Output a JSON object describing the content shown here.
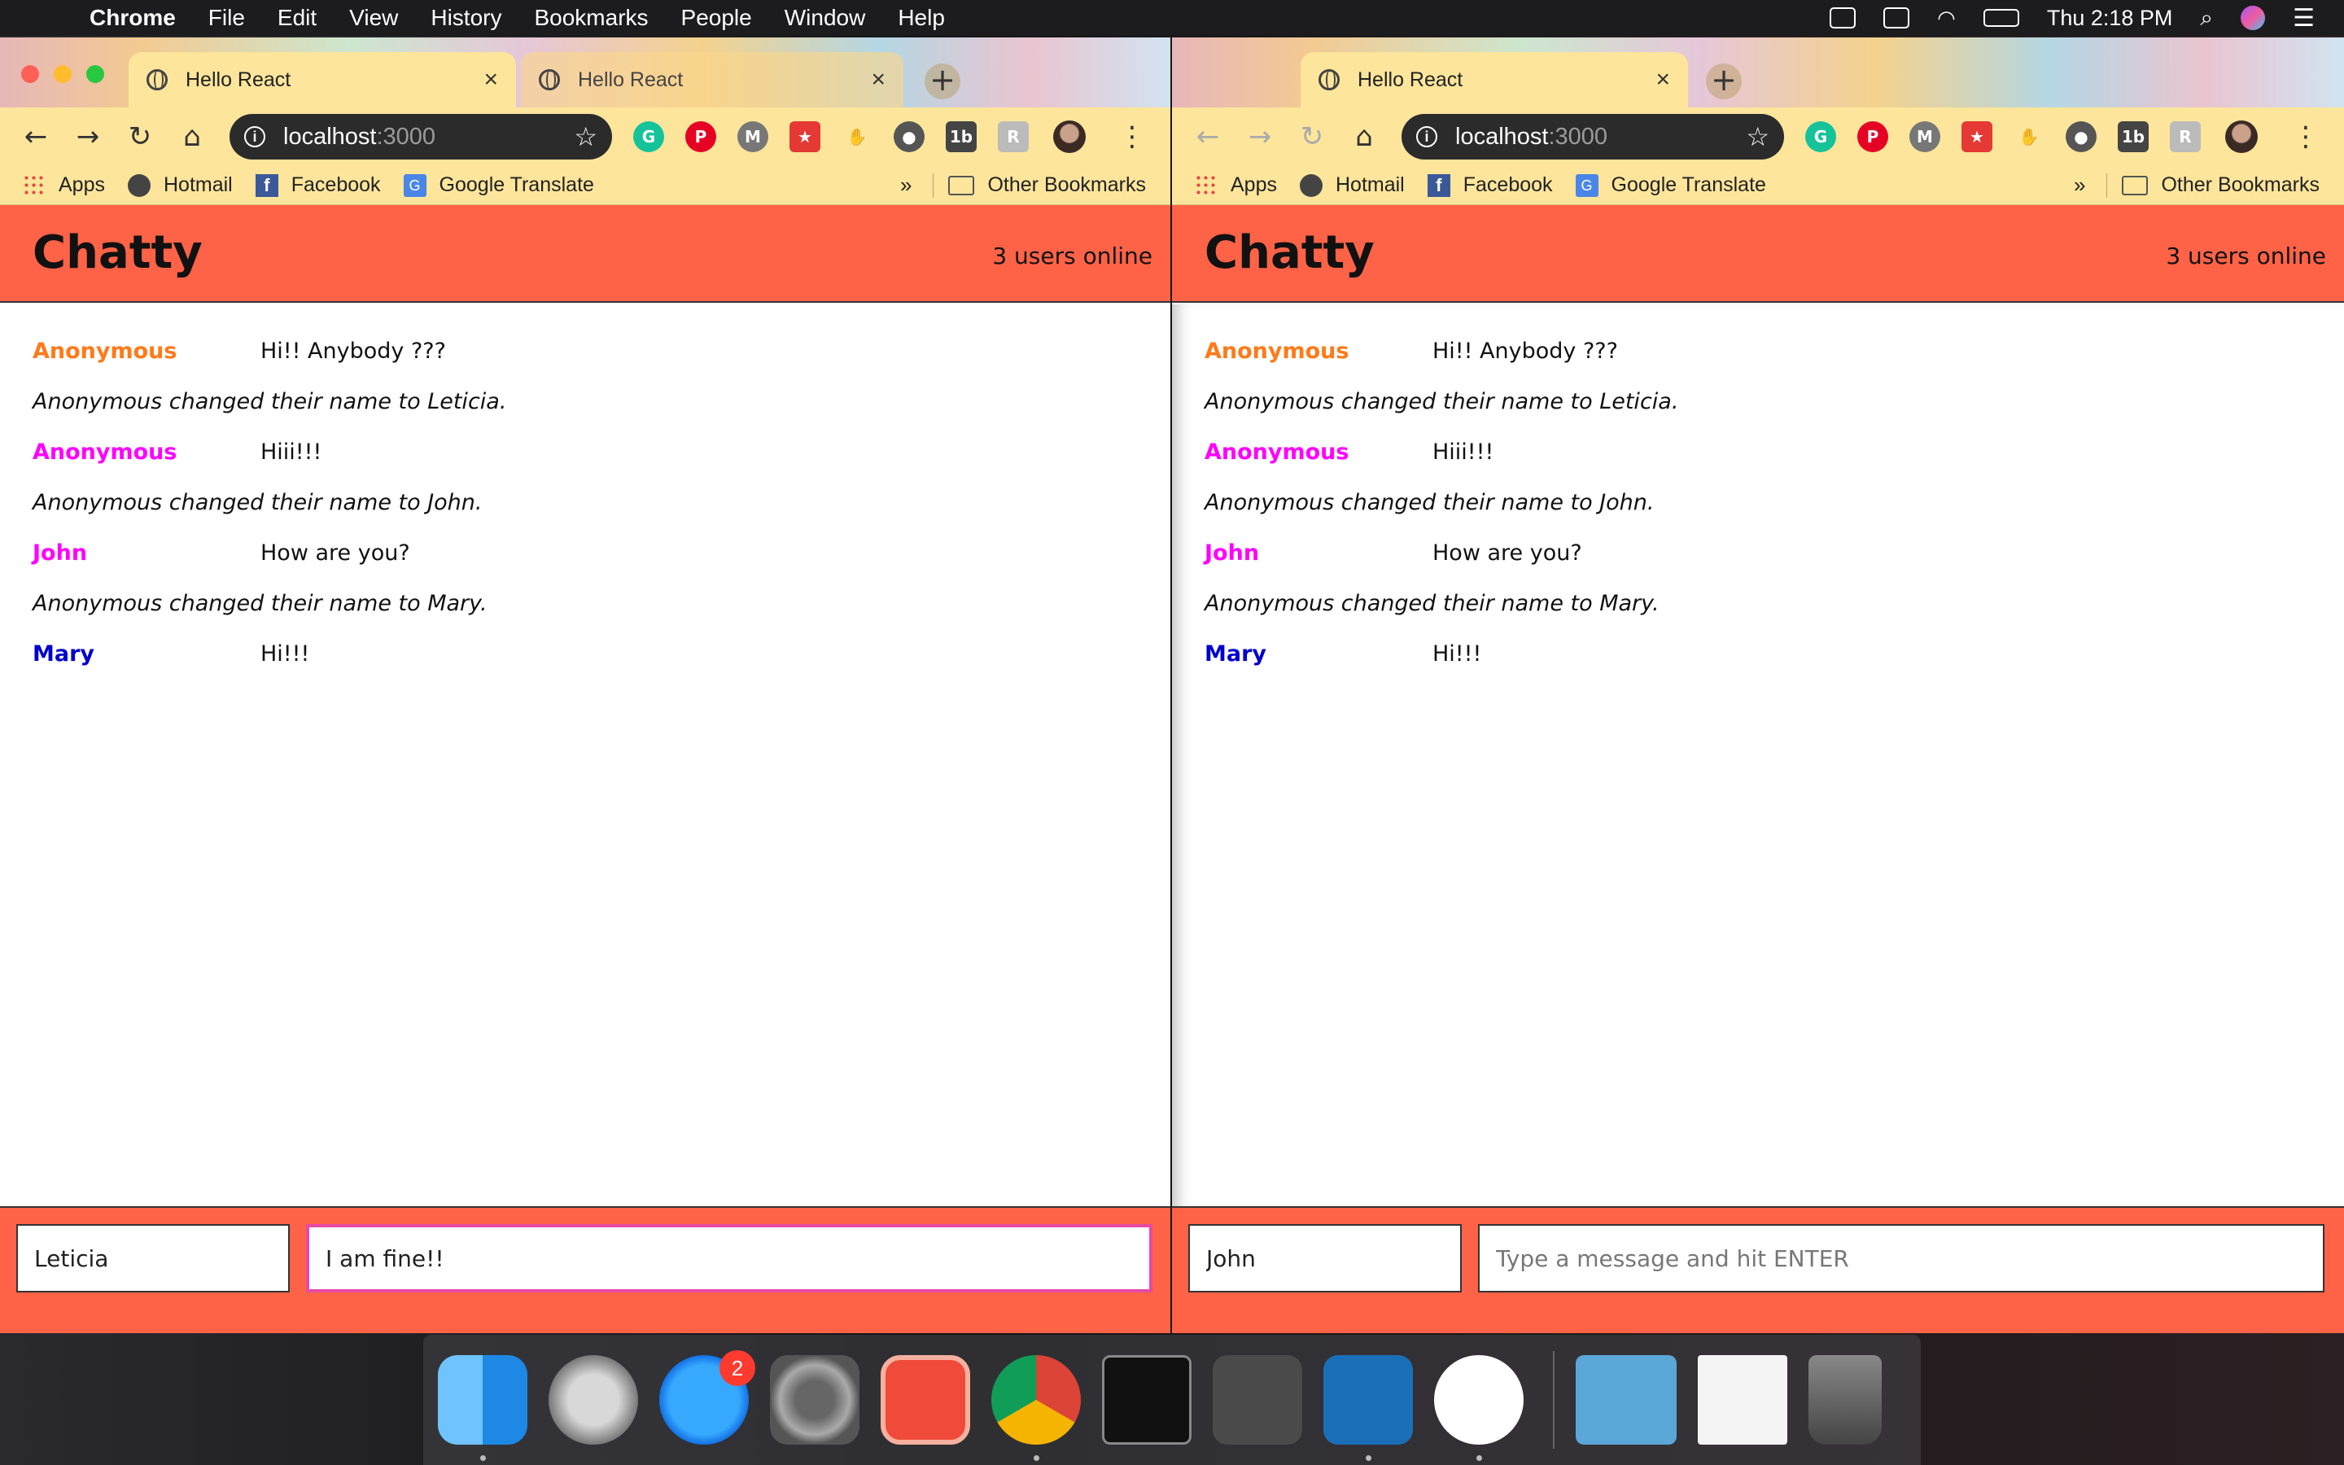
{
  "menubar": {
    "app": "Chrome",
    "items": [
      "File",
      "Edit",
      "View",
      "History",
      "Bookmarks",
      "People",
      "Window",
      "Help"
    ],
    "clock": "Thu 2:18 PM"
  },
  "browser": {
    "left_tabs": [
      {
        "title": "Hello React"
      },
      {
        "title": "Hello React"
      }
    ],
    "right_tabs": [
      {
        "title": "Hello React"
      }
    ],
    "url_host": "localhost",
    "url_port": ":3000",
    "bookmarks": [
      "Apps",
      "Hotmail",
      "Facebook",
      "Google Translate"
    ],
    "other_bookmarks": "Other Bookmarks",
    "chevron": "»"
  },
  "app": {
    "title": "Chatty",
    "users_online": "3 users online",
    "colors": {
      "header": "#ff6347",
      "anonymous_1": "#ff7a1a",
      "anonymous_2": "#ff00ff",
      "john": "#ff00ff",
      "mary": "#0000cc"
    },
    "messages": [
      {
        "type": "message",
        "user": "Anonymous",
        "color": "#ff7a1a",
        "text": "Hi!! Anybody ???"
      },
      {
        "type": "notification",
        "text": "Anonymous changed their name to Leticia."
      },
      {
        "type": "message",
        "user": "Anonymous",
        "color": "#ff00ff",
        "text": "Hiii!!!"
      },
      {
        "type": "notification",
        "text": "Anonymous changed their name to John."
      },
      {
        "type": "message",
        "user": "John",
        "color": "#ff00ff",
        "text": "How are you?"
      },
      {
        "type": "notification",
        "text": "Anonymous changed their name to Mary."
      },
      {
        "type": "message",
        "user": "Mary",
        "color": "#0000cc",
        "text": "Hi!!!"
      }
    ]
  },
  "left_window": {
    "username_value": "Leticia",
    "message_value": "I am fine!!"
  },
  "right_window": {
    "username_value": "John",
    "message_placeholder": "Type a message and hit ENTER"
  },
  "dock": {
    "apps": [
      "finder-icon",
      "launchpad-icon",
      "app-store-icon",
      "system-preferences-icon",
      "bookmarks-icon",
      "chrome-icon",
      "terminal-icon",
      "sublime-icon",
      "vscode-icon",
      "slack-icon",
      "downloads-icon",
      "screenshot-icon",
      "trash-icon"
    ],
    "app_store_badge": "2"
  }
}
